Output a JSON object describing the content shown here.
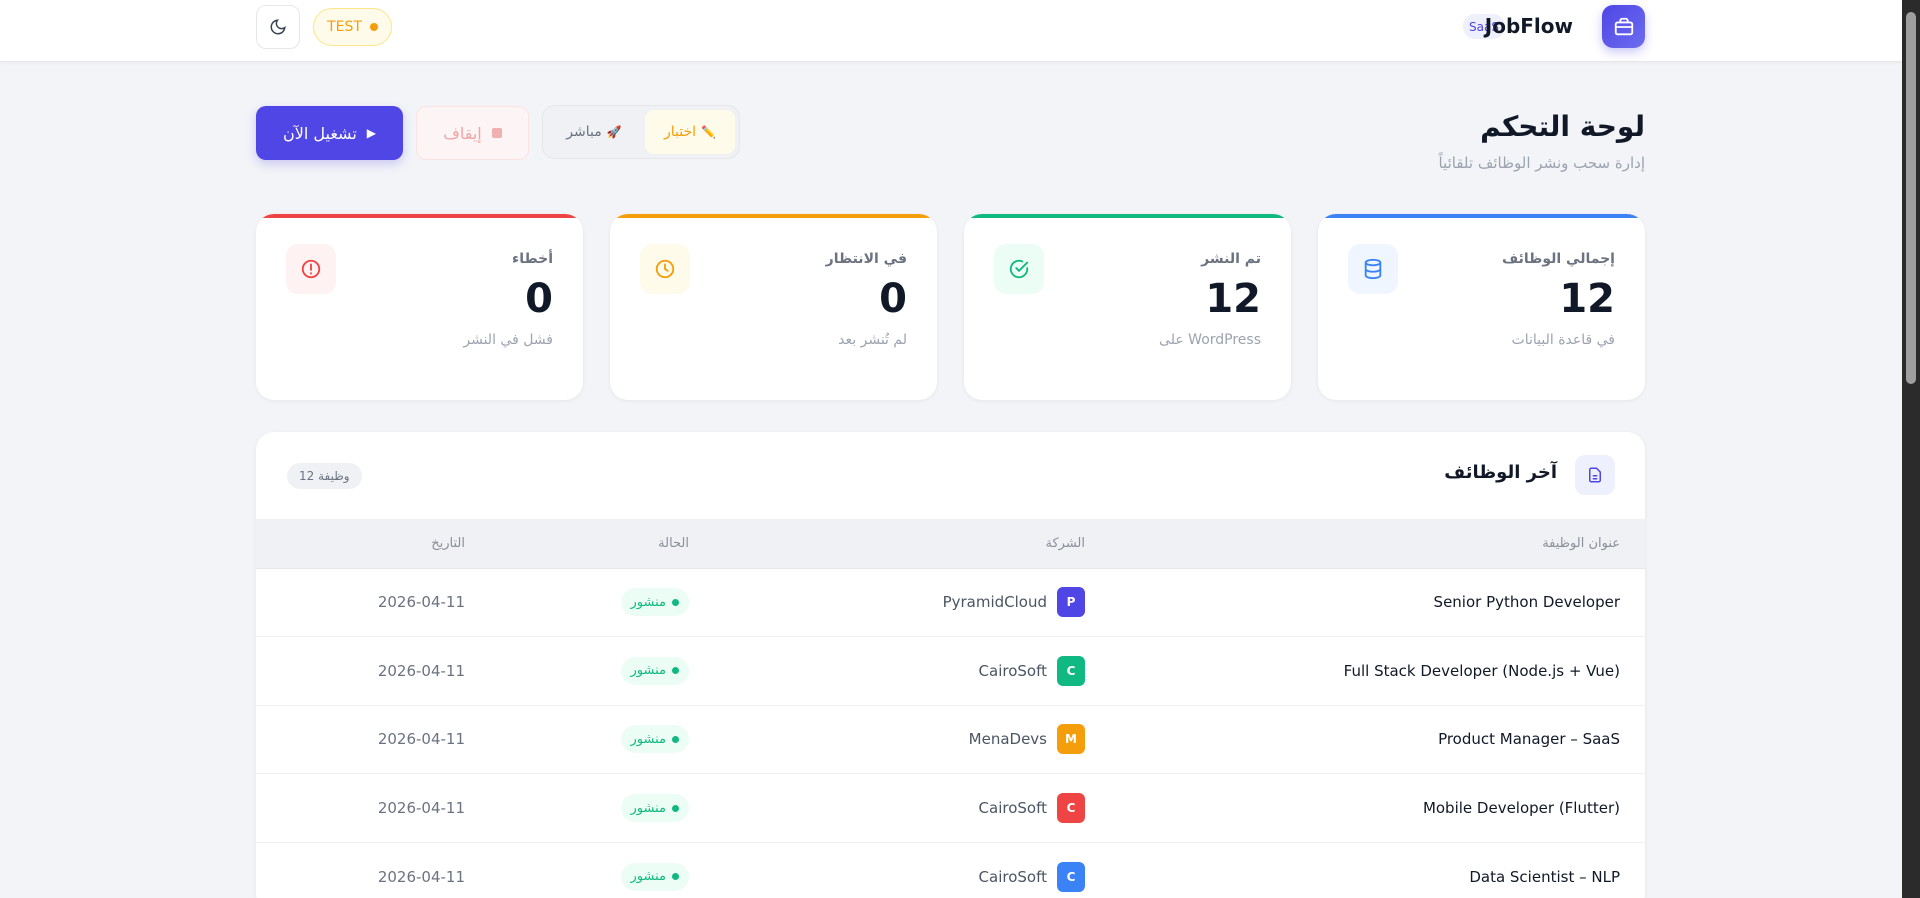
{
  "header": {
    "brand": "JobFlow",
    "badge": "SaaS",
    "env_badge": "TEST",
    "theme_icon": "moon-icon",
    "logo_icon": "briefcase-icon"
  },
  "page": {
    "title": "لوحة التحكم",
    "subtitle": "إدارة سحب ونشر الوظائف تلقائياً"
  },
  "actions": {
    "run_now": "تشغيل الآن",
    "stop": "إيقاف",
    "mode_test": "اختبار",
    "mode_live": "مباشر",
    "mode_test_icon": "✏️",
    "mode_live_icon": "🚀",
    "selected_mode": "اختبار"
  },
  "stats": [
    {
      "label": "إجمالي الوظائف",
      "value": "12",
      "sub": "في قاعدة البيانات",
      "color": "#3b82f6",
      "icon": "database-icon"
    },
    {
      "label": "تم النشر",
      "value": "12",
      "sub": "على WordPress",
      "color": "#10b981",
      "icon": "check-circle-icon"
    },
    {
      "label": "في الانتظار",
      "value": "0",
      "sub": "لم تُنشر بعد",
      "color": "#f59e0b",
      "icon": "clock-icon"
    },
    {
      "label": "أخطاء",
      "value": "0",
      "sub": "فشل في النشر",
      "color": "#ef4444",
      "icon": "alert-circle-icon"
    }
  ],
  "jobs": {
    "title": "آخر الوظائف",
    "count": "12 وظيفة",
    "columns": [
      "عنوان الوظيفة",
      "الشركة",
      "الحالة",
      "التاريخ"
    ],
    "rows": [
      {
        "title": "Senior Python Developer",
        "company": "PyramidCloud",
        "initial": "P",
        "color": "#4f46e5",
        "status": "منشور",
        "date": "2026-04-11"
      },
      {
        "title": "Full Stack Developer (Node.js + Vue)",
        "company": "CairoSoft",
        "initial": "C",
        "color": "#10b981",
        "status": "منشور",
        "date": "2026-04-11"
      },
      {
        "title": "Product Manager – SaaS",
        "company": "MenaDevs",
        "initial": "M",
        "color": "#f59e0b",
        "status": "منشور",
        "date": "2026-04-11"
      },
      {
        "title": "Mobile Developer (Flutter)",
        "company": "CairoSoft",
        "initial": "C",
        "color": "#ef4444",
        "status": "منشور",
        "date": "2026-04-11"
      },
      {
        "title": "Data Scientist – NLP",
        "company": "CairoSoft",
        "initial": "C",
        "color": "#3b82f6",
        "status": "منشور",
        "date": "2026-04-11"
      }
    ]
  }
}
